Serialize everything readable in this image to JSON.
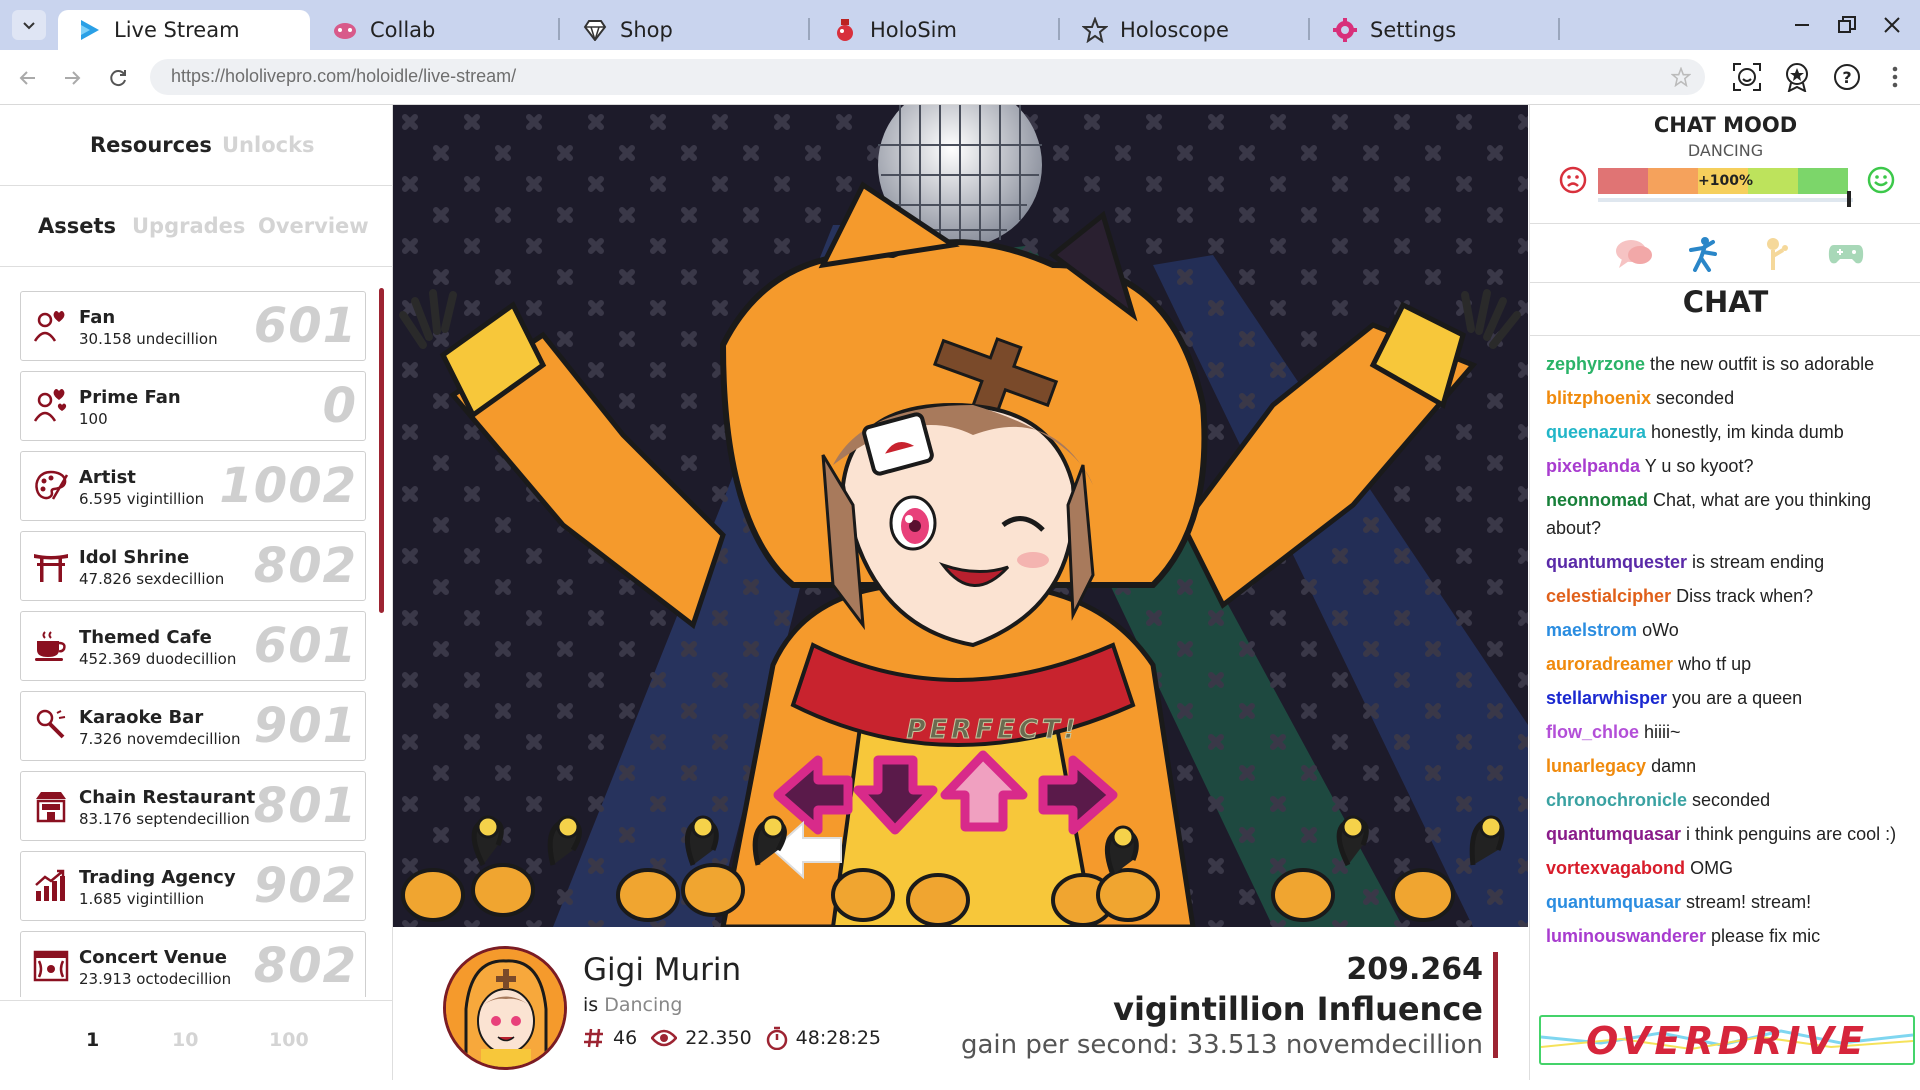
{
  "tabs": [
    {
      "label": "Live Stream",
      "icon": "play-icon"
    },
    {
      "label": "Collab",
      "icon": "gamepad-icon"
    },
    {
      "label": "Shop",
      "icon": "gem-icon"
    },
    {
      "label": "HoloSim",
      "icon": "potion-icon"
    },
    {
      "label": "Holoscope",
      "icon": "star-outline-icon"
    },
    {
      "label": "Settings",
      "icon": "gear-icon"
    }
  ],
  "address": {
    "url": "https://hololivepro.com/holoidle/live-stream/"
  },
  "left_panel": {
    "top_tabs": {
      "resources": "Resources",
      "unlocks": "Unlocks"
    },
    "sub_tabs": {
      "assets": "Assets",
      "upgrades": "Upgrades",
      "overview": "Overview"
    },
    "assets": [
      {
        "name": "Fan",
        "amount": "30.158 undecillion",
        "count": "601",
        "icon": "fan-heart-icon"
      },
      {
        "name": "Prime Fan",
        "amount": "100",
        "count": "0",
        "icon": "prime-fan-icon"
      },
      {
        "name": "Artist",
        "amount": "6.595 vigintillion",
        "count": "1002",
        "icon": "palette-icon"
      },
      {
        "name": "Idol Shrine",
        "amount": "47.826 sexdecillion",
        "count": "802",
        "icon": "torii-gate-icon"
      },
      {
        "name": "Themed Cafe",
        "amount": "452.369 duodecillion",
        "count": "601",
        "icon": "coffee-cup-icon"
      },
      {
        "name": "Karaoke Bar",
        "amount": "7.326 novemdecillion",
        "count": "901",
        "icon": "microphone-icon"
      },
      {
        "name": "Chain Restaurant",
        "amount": "83.176 septendecillion",
        "count": "801",
        "icon": "restaurant-icon"
      },
      {
        "name": "Trading Agency",
        "amount": "1.685 vigintillion",
        "count": "902",
        "icon": "bar-chart-icon"
      },
      {
        "name": "Concert Venue",
        "amount": "23.913 octodecillion",
        "count": "802",
        "icon": "stage-icon"
      }
    ],
    "pager": [
      "1",
      "10",
      "100"
    ]
  },
  "stage": {
    "judgement": "PERFECT!"
  },
  "streamer": {
    "name": "Gigi Murin",
    "is_label": "is",
    "status": "Dancing",
    "rank": "46",
    "viewers": "22.350",
    "duration": "48:28:25",
    "influence_value": "209.264",
    "influence_label": "vigintillion Influence",
    "gain": "gain per second: 33.513 novemdecillion"
  },
  "chat_mood": {
    "title": "CHAT MOOD",
    "status": "DANCING",
    "bonus": "+100%",
    "colors": [
      "#e07474",
      "#f5a25c",
      "#f5cf5c",
      "#bde35c",
      "#7cd66a"
    ]
  },
  "chat": {
    "title": "CHAT",
    "messages": [
      {
        "user": "zephyrzone",
        "text": "the new outfit is so adorable",
        "color": "#2ab368"
      },
      {
        "user": "blitzphoenix",
        "text": "seconded",
        "color": "#f08a0c"
      },
      {
        "user": "queenazura",
        "text": "honestly, im kinda dumb",
        "color": "#22b6c8"
      },
      {
        "user": "pixelpanda",
        "text": "Y u so kyoot?",
        "color": "#a83ccf"
      },
      {
        "user": "neonnomad",
        "text": "Chat, what are you thinking about?",
        "color": "#18803a"
      },
      {
        "user": "quantumquester",
        "text": "is stream ending",
        "color": "#5a2aa8"
      },
      {
        "user": "celestialcipher",
        "text": "Diss track when?",
        "color": "#e0601a"
      },
      {
        "user": "maelstrom",
        "text": "oWo",
        "color": "#2b8de0"
      },
      {
        "user": "auroradreamer",
        "text": "who tf up",
        "color": "#f08a0c"
      },
      {
        "user": "stellarwhisper",
        "text": "you are a queen",
        "color": "#1a28d0"
      },
      {
        "user": "flow_chloe",
        "text": "hiiii~",
        "color": "#b34fd8"
      },
      {
        "user": "lunarlegacy",
        "text": "damn",
        "color": "#f08a0c"
      },
      {
        "user": "chronochronicle",
        "text": "seconded",
        "color": "#3aa2a2"
      },
      {
        "user": "quantumquasar",
        "text": "i think penguins are cool :)",
        "color": "#8a1c8a"
      },
      {
        "user": "vortexvagabond",
        "text": "OMG",
        "color": "#d81c2a"
      },
      {
        "user": "quantumquasar",
        "text": "stream! stream!",
        "color": "#2b8de0"
      },
      {
        "user": "luminouswanderer",
        "text": "please fix mic",
        "color": "#a83ccf"
      }
    ]
  },
  "overdrive": {
    "label": "OVERDRIVE"
  }
}
